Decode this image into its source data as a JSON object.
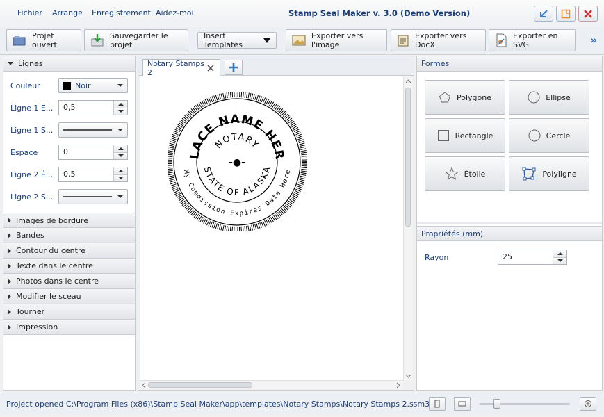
{
  "menu": [
    "Fichier",
    "Arrange",
    "Enregistrement",
    "Aidez-moi"
  ],
  "app_title": "Stamp Seal Maker v. 3.0 (Demo Version)",
  "toolbar": {
    "open": "Projet ouvert",
    "save": "Sauvegarder le projet",
    "templates": "Insert Templates",
    "export_image": "Exporter vers l'image",
    "export_docx": "Exporter vers DocX",
    "export_svg": "Exporter en SVG",
    "more": "»"
  },
  "lines_panel": {
    "title": "Lignes",
    "color_label": "Couleur",
    "color_value": "Noir",
    "color_hex": "#000000",
    "line1_width_label": "Ligne 1 E...",
    "line1_width": "0,5",
    "line1_style_label": "Ligne 1 S...",
    "space_label": "Espace",
    "space": "0",
    "line2_width_label": "Ligne 2 É...",
    "line2_width": "0,5",
    "line2_style_label": "Ligne 2 S..."
  },
  "sections": [
    "Images de bordure",
    "Bandes",
    "Contour du centre",
    "Texte dans le centre",
    "Photos dans le centre",
    "Modifier le sceau",
    "Tourner",
    "Impression"
  ],
  "document_tab": "Notary Stamps 2",
  "seal": {
    "top_text": "PLACE NAME HERE",
    "inner_top_text": "NOTARY",
    "inner_bottom_text": "STATE OF ALASKA",
    "bottom_text": "My Commission Expires Date Here",
    "center_text": "-●-"
  },
  "shapes_panel": {
    "title": "Formes",
    "items": [
      "Polygone",
      "Ellipse",
      "Rectangle",
      "Cercle",
      "Étoile",
      "Polyligne"
    ]
  },
  "properties_panel": {
    "title": "Propriétés (mm)",
    "radius_label": "Rayon",
    "radius": "25"
  },
  "status": "Project opened C:\\Program Files (x86)\\Stamp Seal Maker\\app\\templates\\Notary Stamps\\Notary Stamps 2.ssm3",
  "zoom_level": 0.17
}
